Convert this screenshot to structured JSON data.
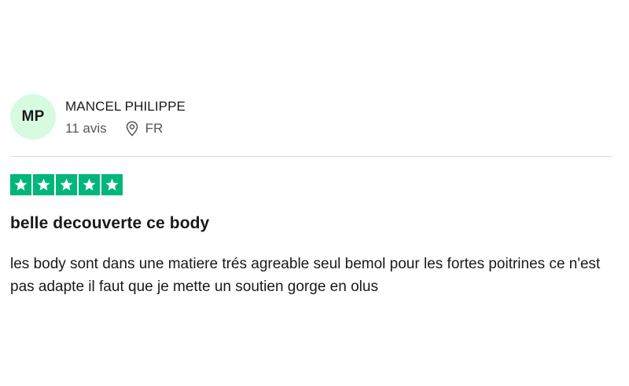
{
  "reviewer": {
    "initials": "MP",
    "name": "MANCEL PHILIPPE",
    "review_count": "11 avis",
    "location_icon": "location-pin-icon",
    "country": "FR"
  },
  "rating": {
    "stars": 5,
    "max_stars": 5,
    "star_color": "#00b67a",
    "star_icon": "star-icon"
  },
  "review": {
    "title": "belle decouverte ce body",
    "text": "les body sont dans une matiere trés agreable seul bemol pour les fortes poitrines ce n'est pas adapte il faut que je mette un soutien gorge en olus"
  },
  "colors": {
    "avatar_bg": "#d7fbe1",
    "divider": "#d6d6d6"
  }
}
